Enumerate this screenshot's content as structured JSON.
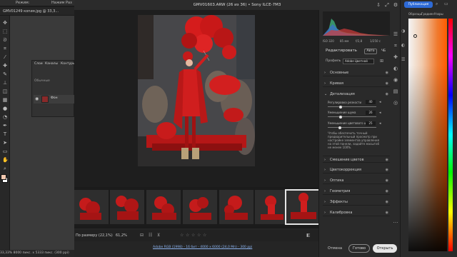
{
  "ps": {
    "options": [
      "Режим:",
      "Нажим",
      "Раз"
    ],
    "tabs": [
      "GMV01249 копия.jpg @ 33,3..."
    ],
    "layers_tabs": [
      "Слои",
      "Каналы",
      "Контуры"
    ],
    "layer_kind": "Обычные",
    "layer_name": "Фон",
    "status": "33,33%    8000 пикс. x 5333 пикс. (300 ppi)"
  },
  "acr": {
    "title": "GMV01603.ARW (26 из 36)  •  Sony ILCE-7M3",
    "fit_label": "По размеру (22,1%)",
    "zoom_label": "61,2%",
    "footer_info": "Adobe RGB (1998) - 16 бит - 4000 x 6000 (24,0 Мп) - 300 ppi",
    "stars": [
      "☆",
      "☆",
      "☆",
      "☆",
      "☆"
    ],
    "exif": {
      "iso": "ISO 320",
      "focal": "85 мм",
      "aperture": "f/2,8",
      "shutter": "1/250 с"
    },
    "edit": {
      "label": "Редактировать",
      "auto": "Авто",
      "bw": "ЧБ"
    },
    "profile": {
      "label": "Профиль",
      "value": "Adobe Цветной"
    },
    "sections": {
      "basic": "Основные",
      "curve": "Кривая",
      "detail": "Детализация",
      "mixer": "Смешение цветов",
      "color_grading": "Цветокоррекция",
      "optics": "Оптика",
      "geometry": "Геометрия",
      "effects": "Эффекты",
      "calibration": "Калибровка"
    },
    "sliders": [
      {
        "label": "Регулировка резкости",
        "value": "40",
        "fraction": 0.27
      },
      {
        "label": "Уменьшение шума",
        "value": "26",
        "fraction": 0.26
      },
      {
        "label": "Уменьшение цветового шу...",
        "value": "25",
        "fraction": 0.25
      }
    ],
    "note": "Чтобы обеспечить точный предварительный просмотр при настройке элементов управления на этой панели, задайте масштаб не менее 100%.",
    "buttons": {
      "cancel": "Отмена",
      "done": "Готово",
      "open": "Открыть"
    }
  },
  "cp": {
    "share": "Публикация",
    "tabs": [
      "Образцы",
      "Градиен",
      "Узоры"
    ]
  }
}
